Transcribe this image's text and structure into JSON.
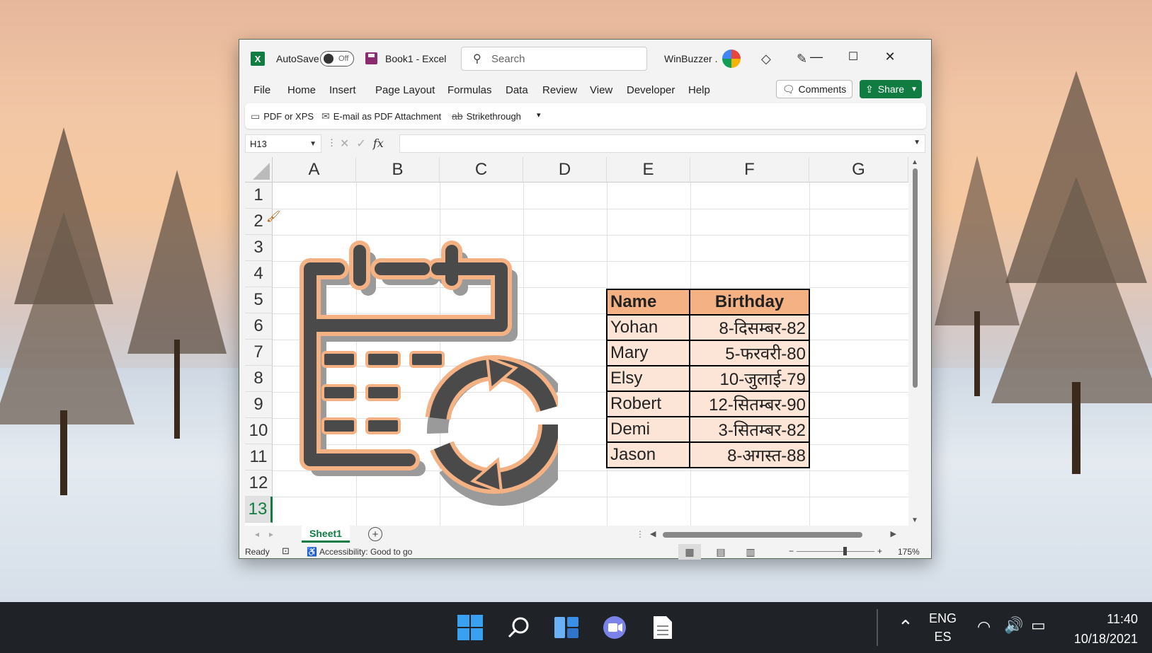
{
  "window": {
    "autosave_label": "AutoSave",
    "autosave_state": "Off",
    "doc_title": "Book1  -  Excel",
    "search_placeholder": "Search",
    "user_name": "WinBuzzer .",
    "accent": "#107c41"
  },
  "menu": [
    "File",
    "Home",
    "Insert",
    "Page Layout",
    "Formulas",
    "Data",
    "Review",
    "View",
    "Developer",
    "Help"
  ],
  "comments_label": "Comments",
  "share_label": "Share",
  "quick_access": {
    "pdf_xps": "PDF or XPS",
    "email_pdf": "E-mail as PDF Attachment",
    "strikethrough": "Strikethrough"
  },
  "formula_bar": {
    "name_box": "H13",
    "fx_label": "fx",
    "content": ""
  },
  "columns": [
    "A",
    "B",
    "C",
    "D",
    "E",
    "F",
    "G"
  ],
  "rows": [
    "1",
    "2",
    "3",
    "4",
    "5",
    "6",
    "7",
    "8",
    "9",
    "10",
    "11",
    "12",
    "13"
  ],
  "active_row": "13",
  "table": {
    "headers": [
      "Name",
      "Birthday"
    ],
    "rows": [
      [
        "Yohan",
        "8-दिसम्बर-82"
      ],
      [
        "Mary",
        "5-फरवरी-80"
      ],
      [
        "Elsy",
        "10-जुलाई-79"
      ],
      [
        "Robert",
        "12-सितम्बर-90"
      ],
      [
        "Demi",
        "3-सितम्बर-82"
      ],
      [
        "Jason",
        "8-अगस्त-88"
      ]
    ],
    "header_color": "#f4b183",
    "cell_color": "#fce4d6"
  },
  "sheet_tab": "Sheet1",
  "status": {
    "ready": "Ready",
    "accessibility": "Accessibility: Good to go",
    "zoom": "175%"
  },
  "taskbar": {
    "lang_top": "ENG",
    "lang_bottom": "ES",
    "time": "11:40",
    "date": "10/18/2021"
  }
}
